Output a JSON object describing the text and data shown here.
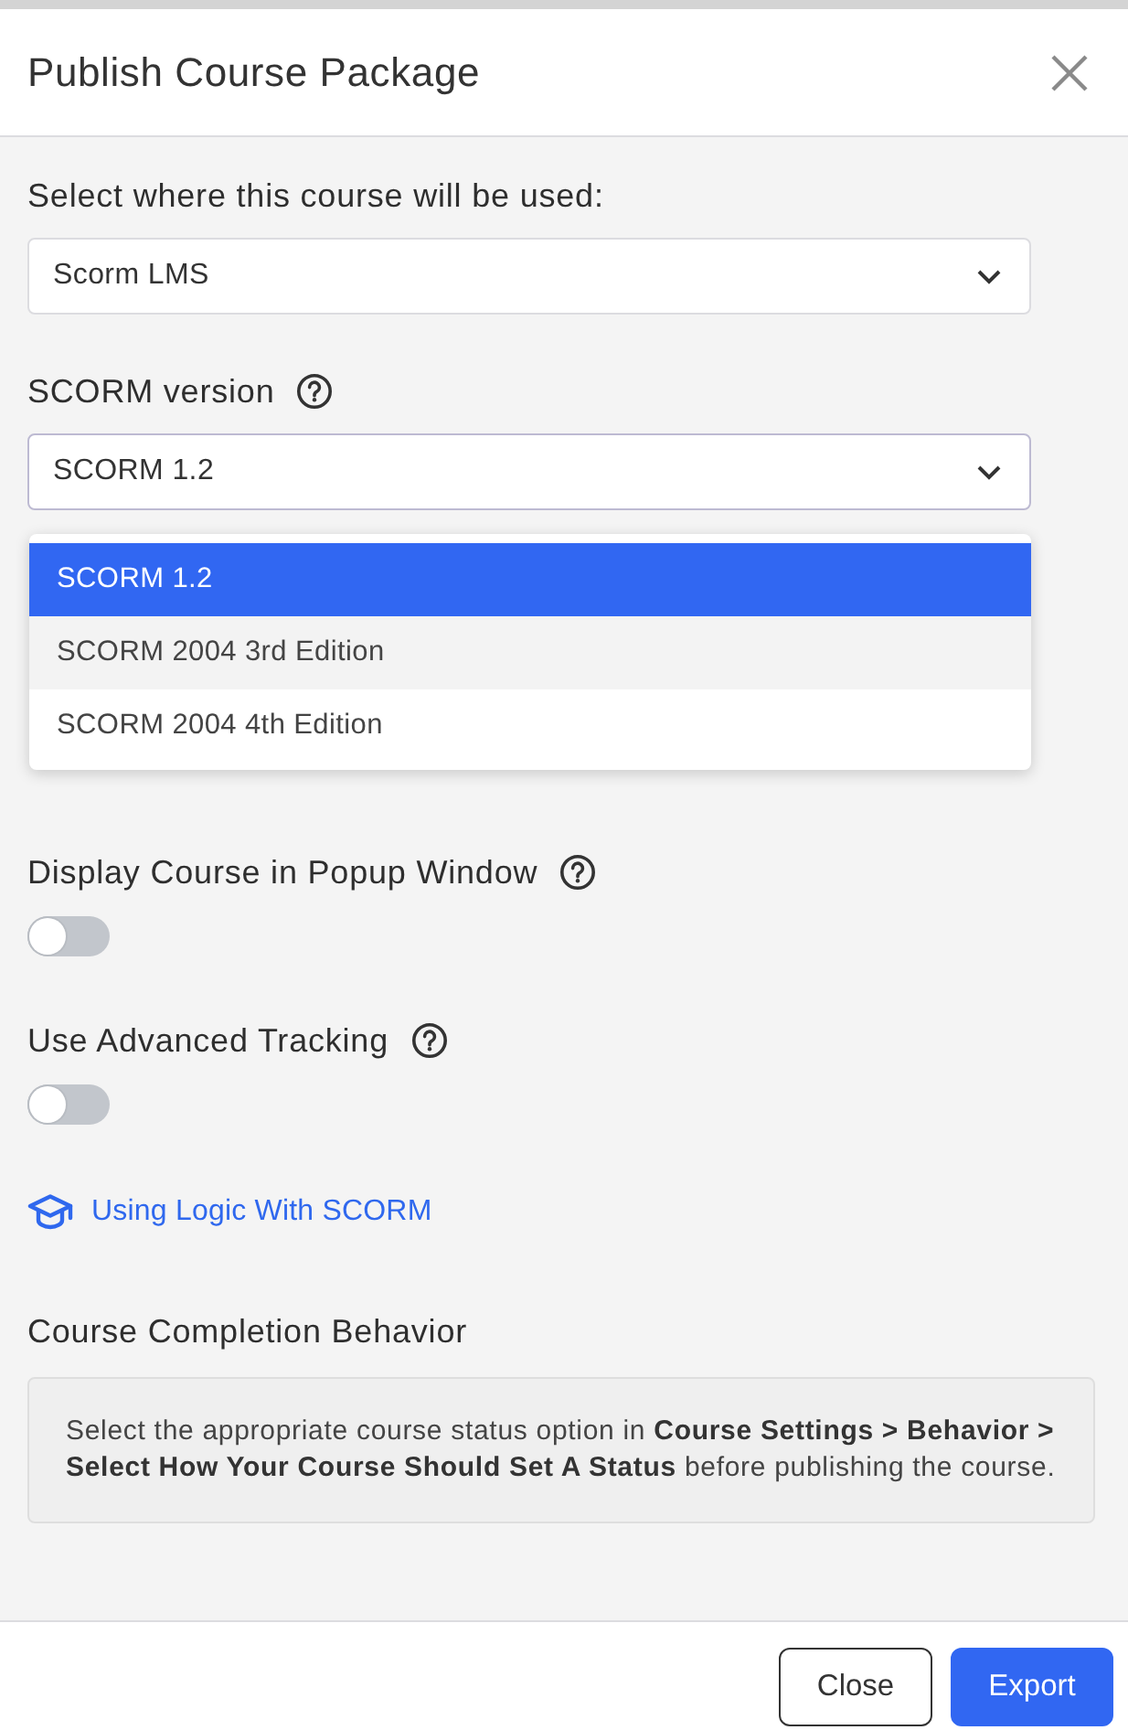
{
  "dialog": {
    "title": "Publish Course Package"
  },
  "fields": [
    {
      "label": "Select where this course will be used:",
      "help": false,
      "value": "Scorm LMS",
      "expanded": false
    },
    {
      "label": "SCORM version",
      "help": true,
      "value": "SCORM 1.2",
      "expanded": true,
      "options": [
        {
          "label": "SCORM 1.2",
          "selected": true,
          "hovered": false
        },
        {
          "label": "SCORM 2004 3rd Edition",
          "selected": false,
          "hovered": true
        },
        {
          "label": "SCORM 2004 4th Edition",
          "selected": false,
          "hovered": false
        }
      ]
    }
  ],
  "toggles": [
    {
      "label": "Display Course in Popup Window",
      "help": true,
      "on": false
    },
    {
      "label": "Use Advanced Tracking",
      "help": true,
      "on": false
    }
  ],
  "link": {
    "text": "Using Logic With SCORM"
  },
  "completion": {
    "heading": "Course Completion Behavior",
    "note": "Select the appropriate course status option in **Course Settings > Behavior > Select How Your Course Should Set A Status** before publishing the course."
  },
  "buttons": [
    {
      "label": "Close",
      "kind": "secondary"
    },
    {
      "label": "Export",
      "kind": "primary"
    }
  ]
}
